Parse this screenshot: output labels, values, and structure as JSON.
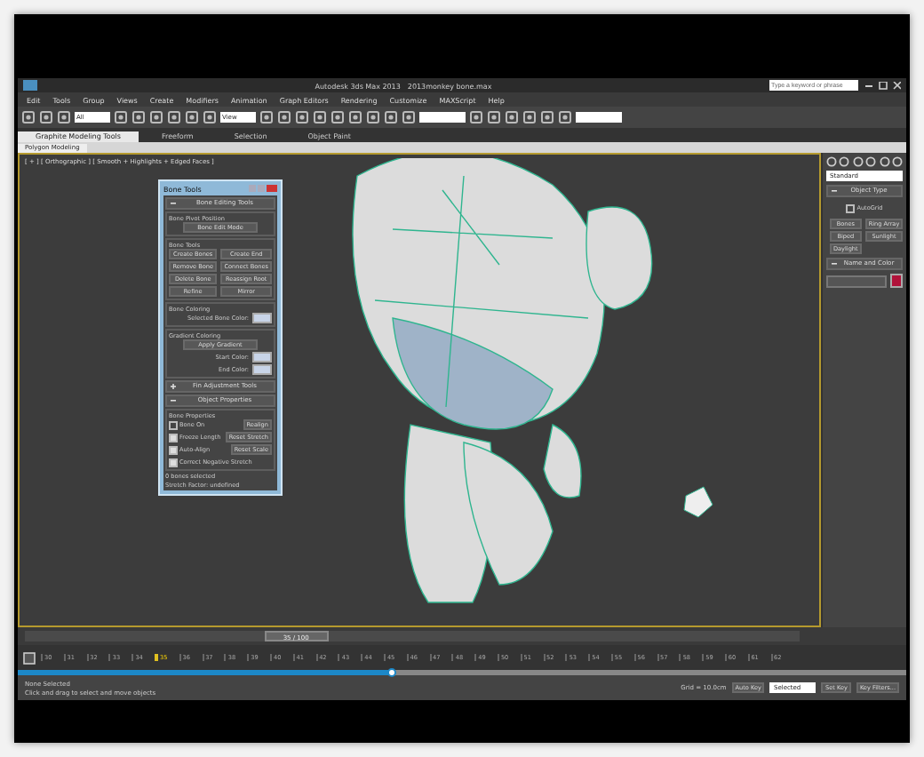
{
  "window": {
    "title": "Autodesk 3ds Max 2013",
    "file": "2013monkey bone.max",
    "search_placeholder": "Type a keyword or phrase"
  },
  "menu": [
    "Edit",
    "Tools",
    "Group",
    "Views",
    "Create",
    "Modifiers",
    "Animation",
    "Graph Editors",
    "Rendering",
    "Customize",
    "MAXScript",
    "Help"
  ],
  "toolbar": {
    "selection_filter": "All",
    "reference_coordinate": "View"
  },
  "ribbon": {
    "tabs": [
      {
        "label": "Graphite Modeling Tools",
        "selected": true
      },
      {
        "label": "Freeform",
        "selected": false
      },
      {
        "label": "Selection",
        "selected": false
      },
      {
        "label": "Object Paint",
        "selected": false
      }
    ],
    "subtab": "Polygon Modeling"
  },
  "viewport": {
    "label": "[ + ] [ Orthographic ] [ Smooth + Highlights + Edged Faces ]",
    "active": true
  },
  "bone_tools": {
    "title": "Bone Tools",
    "rollouts": [
      {
        "title": "Bone Editing Tools",
        "expanded": true,
        "groups": [
          {
            "title": "Bone Pivot Position",
            "buttons": [
              "Bone Edit Mode"
            ]
          },
          {
            "title": "Bone Tools",
            "buttons": [
              "Create Bones",
              "Create End",
              "Remove Bone",
              "Connect Bones",
              "Delete Bone",
              "Reassign Root",
              "Refine",
              "Mirror"
            ]
          },
          {
            "title": "Bone Coloring",
            "swatches": [
              {
                "label": "Selected Bone Color:",
                "color": "#c8d4e8"
              }
            ]
          },
          {
            "title": "Gradient Coloring",
            "buttons": [
              "Apply Gradient"
            ],
            "swatches": [
              {
                "label": "Start Color:",
                "color": "#c8d4e8"
              },
              {
                "label": "End Color:",
                "color": "#c8d4e8"
              }
            ]
          }
        ]
      },
      {
        "title": "Fin Adjustment Tools",
        "expanded": false
      },
      {
        "title": "Object Properties",
        "expanded": true,
        "groups": [
          {
            "title": "Bone Properties",
            "checks": [
              {
                "label": "Bone On",
                "checked": false,
                "button": "Realign"
              },
              {
                "label": "Freeze Length",
                "checked": true,
                "button": "Reset Stretch"
              },
              {
                "label": "Auto-Align",
                "checked": true,
                "button": "Reset Scale"
              },
              {
                "label": "Correct Negative Stretch",
                "checked": true
              }
            ]
          }
        ]
      }
    ],
    "notes": [
      "0 bones selected",
      "Stretch Factor: undefined"
    ]
  },
  "command_panel": {
    "dropdown": "Standard",
    "rollouts": [
      {
        "title": "Object Type",
        "autogrid": {
          "label": "AutoGrid",
          "checked": false
        },
        "buttons": [
          "Bones",
          "Ring Array",
          "Biped",
          "Sunlight",
          "Daylight"
        ]
      },
      {
        "title": "Name and Color",
        "color": "#b0123a"
      }
    ]
  },
  "time_slider": {
    "label": "35 / 100",
    "level": 0.35
  },
  "track_bar": {
    "ticks": [
      {
        "label": "30",
        "selected": false
      },
      {
        "label": "31",
        "selected": false
      },
      {
        "label": "32",
        "selected": false
      },
      {
        "label": "33",
        "selected": false
      },
      {
        "label": "34",
        "selected": false
      },
      {
        "label": "35",
        "selected": true
      },
      {
        "label": "36",
        "selected": false
      },
      {
        "label": "37",
        "selected": false
      },
      {
        "label": "38",
        "selected": false
      },
      {
        "label": "39",
        "selected": false
      },
      {
        "label": "40",
        "selected": false
      },
      {
        "label": "41",
        "selected": false
      },
      {
        "label": "42",
        "selected": false
      },
      {
        "label": "43",
        "selected": false
      },
      {
        "label": "44",
        "selected": false
      },
      {
        "label": "45",
        "selected": false
      },
      {
        "label": "46",
        "selected": false
      },
      {
        "label": "47",
        "selected": false
      },
      {
        "label": "48",
        "selected": false
      },
      {
        "label": "49",
        "selected": false
      },
      {
        "label": "50",
        "selected": false
      },
      {
        "label": "51",
        "selected": false
      },
      {
        "label": "52",
        "selected": false
      },
      {
        "label": "53",
        "selected": false
      },
      {
        "label": "54",
        "selected": false
      },
      {
        "label": "55",
        "selected": false
      },
      {
        "label": "56",
        "selected": false
      },
      {
        "label": "57",
        "selected": false
      },
      {
        "label": "58",
        "selected": false
      },
      {
        "label": "59",
        "selected": false
      },
      {
        "label": "60",
        "selected": false
      },
      {
        "label": "61",
        "selected": false
      },
      {
        "label": "62",
        "selected": false
      }
    ]
  },
  "video_progress": {
    "level": 0.42
  },
  "status": {
    "selection": "None Selected",
    "prompt": "Click and drag to select and move objects",
    "grid": "Grid = 10.0cm",
    "auto_key": "Auto Key",
    "key_mode": "Selected",
    "set_key": "Set Key",
    "key_filters": "Key Filters..."
  }
}
